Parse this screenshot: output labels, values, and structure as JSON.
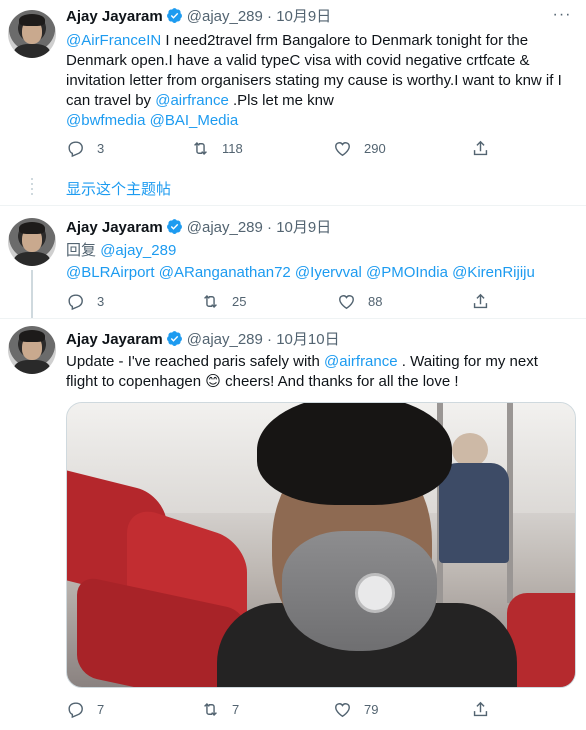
{
  "tweets": [
    {
      "name": "Ajay Jayaram",
      "handle": "@ajay_289",
      "date": "10月9日",
      "text_parts": [
        {
          "t": "@AirFranceIN",
          "link": true
        },
        {
          "t": " I need2travel frm Bangalore to Denmark tonight for the Denmark open.I have a valid typeC visa with covid negative crtfcate & invitation letter from organisers stating my cause is worthy.I want to knw if I can travel by ",
          "link": false
        },
        {
          "t": "@airfrance",
          "link": true
        },
        {
          "t": " .Pls let me knw",
          "link": false
        }
      ],
      "mentions_line": "@bwfmedia @BAI_Media",
      "replies": "3",
      "retweets": "118",
      "likes": "290"
    },
    {
      "name": "Ajay Jayaram",
      "handle": "@ajay_289",
      "date": "10月9日",
      "reply_label": "回复",
      "reply_to": "@ajay_289",
      "mentions_line": "@BLRAirport @ARanganathan72 @Iyervval @PMOIndia @KirenRijiju",
      "replies": "3",
      "retweets": "25",
      "likes": "88"
    },
    {
      "name": "Ajay Jayaram",
      "handle": "@ajay_289",
      "date": "10月10日",
      "text_a": "Update - I've reached paris safely with ",
      "text_link": "@airfrance",
      "text_b": " . Waiting for my next flight to copenhagen",
      "emoji": "😊",
      "text_c": " cheers! And thanks for all the love !",
      "replies": "7",
      "retweets": "7",
      "likes": "79"
    }
  ],
  "show_thread": "显示这个主题帖",
  "more_glyph": "···",
  "colors": {
    "accent": "#1d9bf0",
    "muted": "#536471"
  },
  "icons": [
    "reply-icon",
    "retweet-icon",
    "like-icon",
    "share-icon",
    "verified-icon",
    "more-icon"
  ]
}
